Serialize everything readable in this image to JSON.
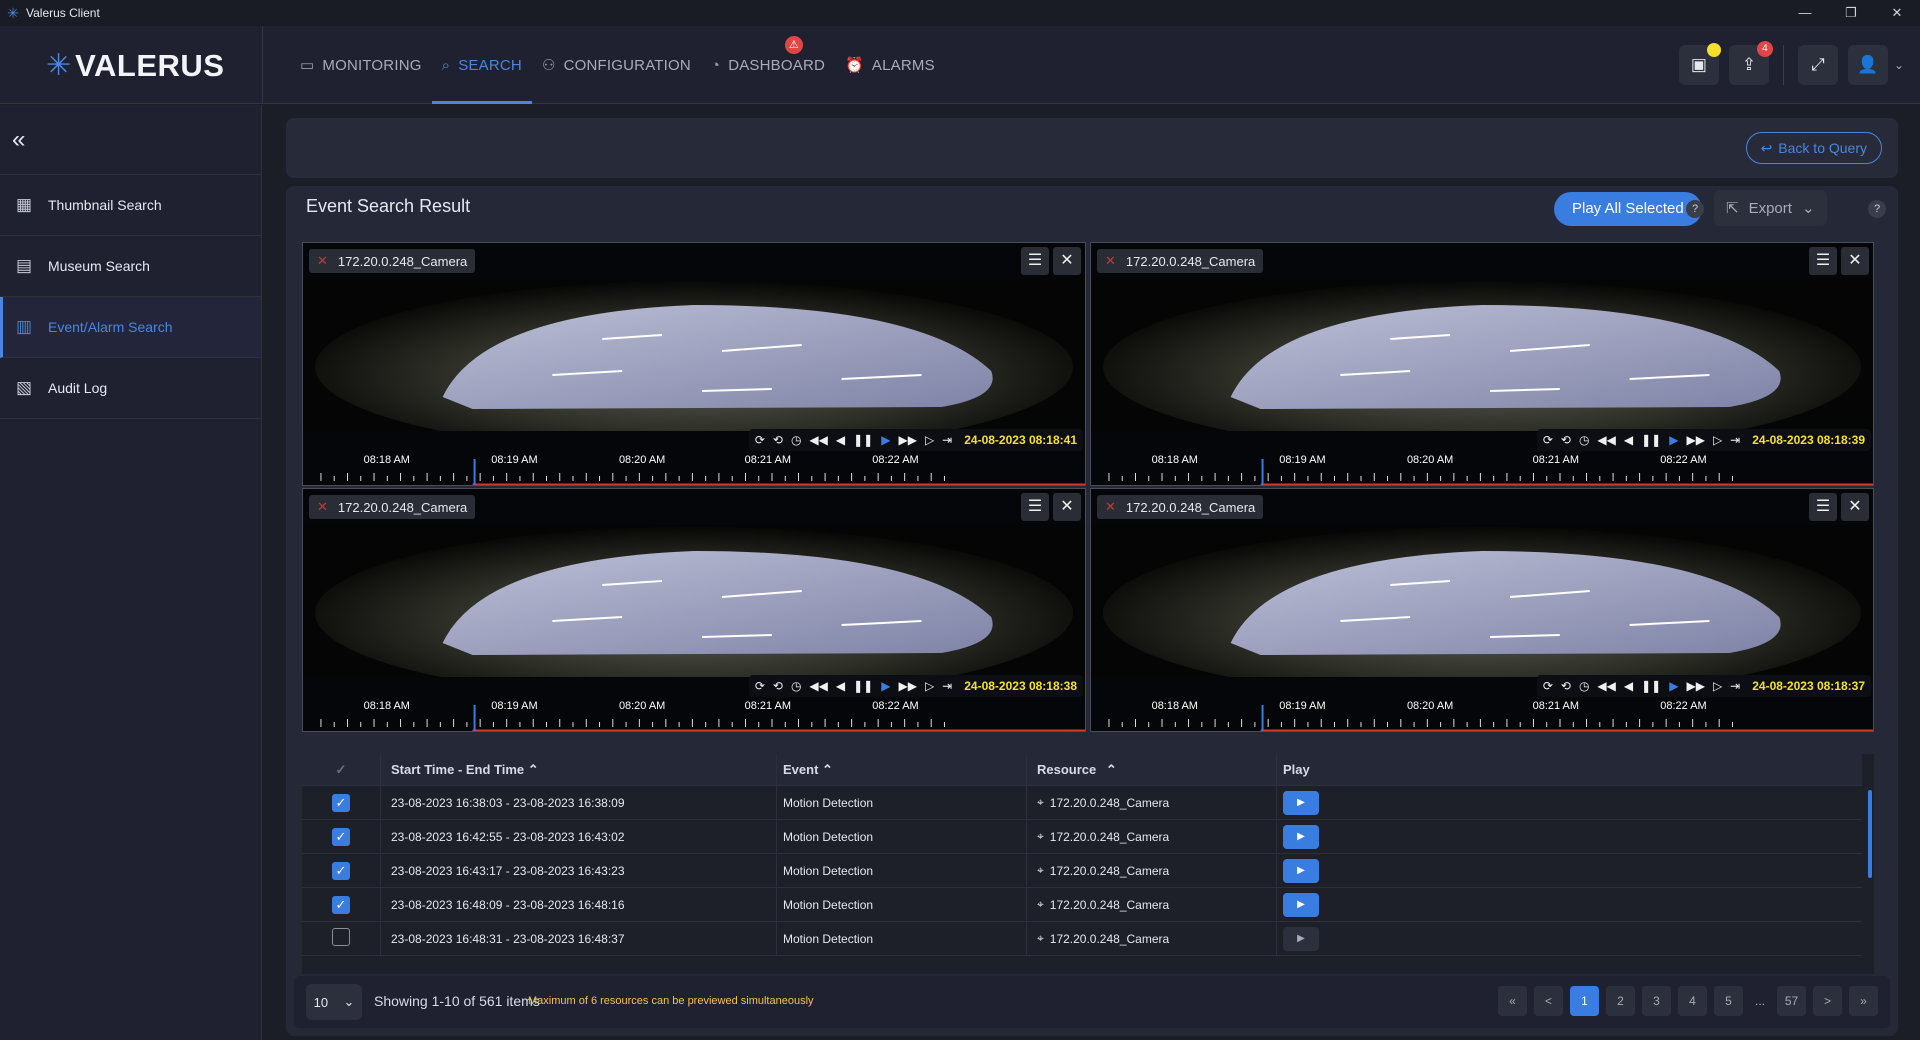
{
  "window": {
    "title": "Valerus Client",
    "page_indicator": "1"
  },
  "brand": {
    "name": "VALERUS"
  },
  "nav": [
    {
      "label": "MONITORING",
      "icon": "monitor-icon"
    },
    {
      "label": "SEARCH",
      "icon": "search-icon",
      "active": true
    },
    {
      "label": "CONFIGURATION",
      "icon": "network-icon"
    },
    {
      "label": "DASHBOARD",
      "icon": "dashboard-icon",
      "badge": "⚠"
    },
    {
      "label": "ALARMS",
      "icon": "alarm-icon"
    }
  ],
  "header_actions": {
    "share_count": "4"
  },
  "sidebar": {
    "items": [
      {
        "label": "Thumbnail Search",
        "icon": "grid-icon"
      },
      {
        "label": "Museum Search",
        "icon": "film-icon"
      },
      {
        "label": "Event/Alarm Search",
        "icon": "chart-icon",
        "active": true
      },
      {
        "label": "Audit Log",
        "icon": "log-icon"
      }
    ]
  },
  "query": {
    "back_label": "Back to Query"
  },
  "results": {
    "title": "Event Search Result",
    "play_all_label": "Play All Selected",
    "export_label": "Export",
    "help": "?"
  },
  "tiles": [
    {
      "camera": "172.20.0.248_Camera",
      "timestamp": "24-08-2023 08:18:41",
      "ticks": [
        "08:18 AM",
        "08:19 AM",
        "08:20 AM",
        "08:21 AM",
        "08:22 AM"
      ]
    },
    {
      "camera": "172.20.0.248_Camera",
      "timestamp": "24-08-2023 08:18:39",
      "ticks": [
        "08:18 AM",
        "08:19 AM",
        "08:20 AM",
        "08:21 AM",
        "08:22 AM"
      ]
    },
    {
      "camera": "172.20.0.248_Camera",
      "timestamp": "24-08-2023 08:18:38",
      "ticks": [
        "08:18 AM",
        "08:19 AM",
        "08:20 AM",
        "08:21 AM",
        "08:22 AM"
      ]
    },
    {
      "camera": "172.20.0.248_Camera",
      "timestamp": "24-08-2023 08:18:37",
      "ticks": [
        "08:18 AM",
        "08:19 AM",
        "08:20 AM",
        "08:21 AM",
        "08:22 AM"
      ]
    }
  ],
  "table": {
    "headers": {
      "time": "Start Time - End Time",
      "event": "Event",
      "resource": "Resource",
      "play": "Play"
    },
    "rows": [
      {
        "checked": true,
        "time": "23-08-2023 16:38:03  - 23-08-2023 16:38:09",
        "event": "Motion Detection",
        "resource": "172.20.0.248_Camera"
      },
      {
        "checked": true,
        "time": "23-08-2023 16:42:55  - 23-08-2023 16:43:02",
        "event": "Motion Detection",
        "resource": "172.20.0.248_Camera"
      },
      {
        "checked": true,
        "time": "23-08-2023 16:43:17  - 23-08-2023 16:43:23",
        "event": "Motion Detection",
        "resource": "172.20.0.248_Camera"
      },
      {
        "checked": true,
        "time": "23-08-2023 16:48:09  - 23-08-2023 16:48:16",
        "event": "Motion Detection",
        "resource": "172.20.0.248_Camera"
      },
      {
        "checked": false,
        "time": "23-08-2023 16:48:31  - 23-08-2023 16:48:37",
        "event": "Motion Detection",
        "resource": "172.20.0.248_Camera"
      }
    ]
  },
  "pagination": {
    "page_size": "10",
    "showing": "Showing 1-10 of 561 items",
    "note": "Maximum of 6 resources can be previewed simultaneously",
    "pages": [
      "«",
      "<",
      "1",
      "2",
      "3",
      "4",
      "5",
      "...",
      "57",
      ">",
      "»"
    ],
    "current": "1"
  },
  "colors": {
    "accent": "#3a7de0",
    "timestamp": "#f5e12a",
    "warning_note": "#f5c242",
    "badge": "#e04646"
  }
}
